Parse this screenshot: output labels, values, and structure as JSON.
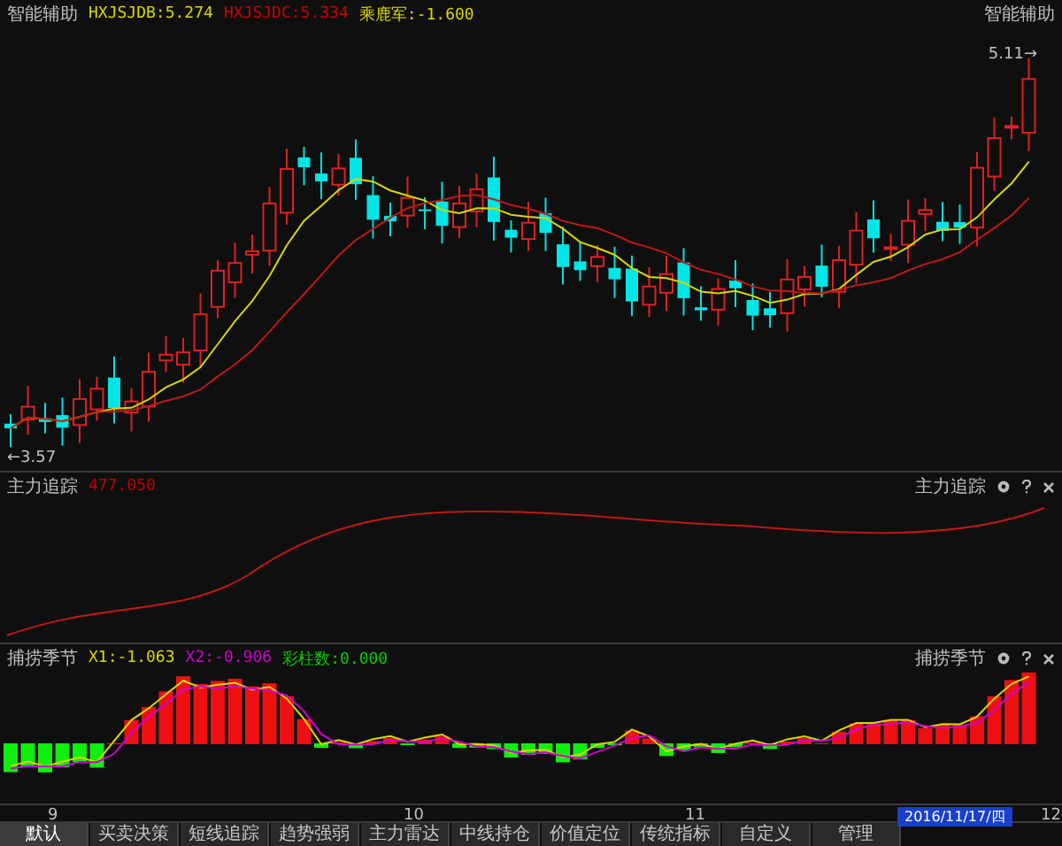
{
  "main": {
    "title": "智能辅助",
    "legend": [
      {
        "label": "HXJSJDB:5.274",
        "color": "#d8d800"
      },
      {
        "label": "HXJSJDC:5.334",
        "color": "#d00000"
      },
      {
        "label": "乘鹿军:-1.600",
        "color": "#d8d800"
      }
    ],
    "corner_label": "智能辅助",
    "high_marker": "5.11→",
    "low_marker": "←3.57"
  },
  "panels": [
    {
      "kind": "curve",
      "title": "主力追踪",
      "legend": [
        {
          "label": "477.050",
          "color": "#c00000"
        }
      ],
      "corner_label": "主力追踪"
    },
    {
      "kind": "histogram",
      "title": "捕捞季节",
      "legend": [
        {
          "label": "X1:-1.063",
          "color": "#d8d800"
        },
        {
          "label": "X2:-0.906",
          "color": "#d000d0"
        },
        {
          "label": "彩柱数:0.000",
          "color": "#00d000"
        }
      ],
      "corner_label": "捕捞季节"
    }
  ],
  "x_axis": {
    "labels": [
      "9",
      "10",
      "11",
      "12"
    ],
    "cursor_date": "2016/11/17/四"
  },
  "tabs": [
    {
      "label": "默认",
      "selected": true
    },
    {
      "label": "买卖决策",
      "selected": false
    },
    {
      "label": "短线追踪",
      "selected": false
    },
    {
      "label": "趋势强弱",
      "selected": false
    },
    {
      "label": "主力雷达",
      "selected": false
    },
    {
      "label": "中线持仓",
      "selected": false
    },
    {
      "label": "价值定位",
      "selected": false
    },
    {
      "label": "传统指标",
      "selected": false
    },
    {
      "label": "自定义",
      "selected": false
    },
    {
      "label": "管理",
      "selected": false
    }
  ]
}
